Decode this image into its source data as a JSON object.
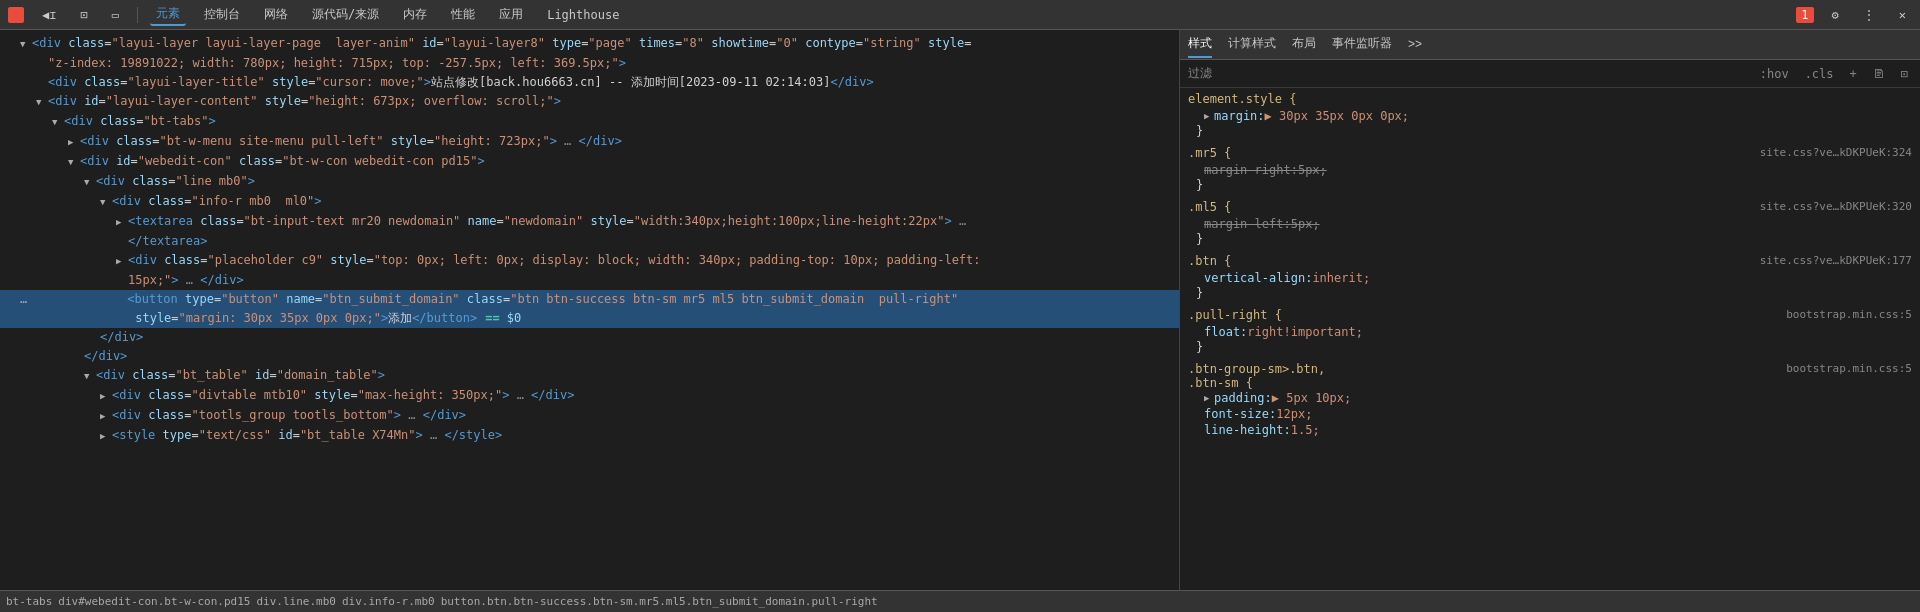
{
  "toolbar": {
    "back_icon": "◀",
    "forward_icon": "▶",
    "inspect_icon": "⊡",
    "device_icon": "▭",
    "tabs": [
      {
        "label": "元素",
        "active": true
      },
      {
        "label": "控制台"
      },
      {
        "label": "网络"
      },
      {
        "label": "源代码/来源"
      },
      {
        "label": "内存"
      },
      {
        "label": "性能"
      },
      {
        "label": "应用"
      },
      {
        "label": "Lighthouse"
      }
    ],
    "settings_icon": "⚙",
    "more_icon": "⋮",
    "close_icon": "✕",
    "brand_label": "1"
  },
  "dom": {
    "lines": [
      {
        "id": "line1",
        "indent": 0,
        "expand": "expanded",
        "content": "<div class=\"layui-layer layui-layer-page  layer-anim\" id=\"layui-layer8\" type=\"page\" times=\"8\" showtime=\"0\" contype=\"string\" style=",
        "continuation": "\"z-index: 19891022; width: 780px; height: 715px; top: -257.5px; left: 369.5px;\">",
        "selected": false
      },
      {
        "id": "line2",
        "indent": 1,
        "expand": "leaf",
        "content": "<div class=\"layui-layer-title\" style=\"cursor: move;\">站点修改[back.hou6663.cn] -- 添加时间[2023-09-11 02:14:03]</div>",
        "selected": false
      },
      {
        "id": "line3",
        "indent": 1,
        "expand": "expanded",
        "content": "<div id=\"layui-layer-content\" style=\"height: 673px; overflow: scroll;\">",
        "selected": false
      },
      {
        "id": "line4",
        "indent": 2,
        "expand": "expanded",
        "content": "<div class=\"bt-tabs\">",
        "selected": false
      },
      {
        "id": "line5",
        "indent": 3,
        "expand": "collapsed",
        "content": "<div class=\"bt-w-menu site-menu pull-left\" style=\"height: 723px;\"> … </div>",
        "selected": false
      },
      {
        "id": "line6",
        "indent": 3,
        "expand": "expanded",
        "content": "<div id=\"webedit-con\" class=\"bt-w-con webedit-con pd15\">",
        "selected": false
      },
      {
        "id": "line7",
        "indent": 4,
        "expand": "expanded",
        "content": "<div class=\"line mb0\">",
        "selected": false
      },
      {
        "id": "line8",
        "indent": 5,
        "expand": "expanded",
        "content": "<div class=\"info-r mb0  ml0\">",
        "selected": false
      },
      {
        "id": "line9",
        "indent": 6,
        "expand": "collapsed",
        "content": "<textarea class=\"bt-input-text mr20 newdomain\" name=\"newdomain\" style=\"width:340px;height:100px;line-height:22px\"> …",
        "continuation": "</textarea>",
        "selected": false
      },
      {
        "id": "line10",
        "indent": 6,
        "expand": "collapsed",
        "content": "<div class=\"placeholder c9\" style=\"top: 0px; left: 0px; display: block; width: 340px; padding-top: 10px; padding-left:",
        "continuation": "15px;\"> … </div>",
        "selected": false
      },
      {
        "id": "line11",
        "indent": 6,
        "expand": "leaf",
        "three_dots": true,
        "content": "<button type=\"button\" name=\"btn_submit_domain\" class=\"btn btn-success btn-sm mr5 ml5 btn_submit_domain  pull-right\"",
        "continuation": "  style=\"margin: 30px 35px 0px 0px;\">添加</button>",
        "equals": "== $0",
        "selected": true
      },
      {
        "id": "line12",
        "indent": 5,
        "expand": "leaf",
        "content": "</div>",
        "selected": false
      },
      {
        "id": "line13",
        "indent": 4,
        "expand": "leaf",
        "content": "</div>",
        "selected": false
      },
      {
        "id": "line14",
        "indent": 4,
        "expand": "expanded",
        "content": "<div class=\"bt_table\" id=\"domain_table\">",
        "selected": false
      },
      {
        "id": "line15",
        "indent": 5,
        "expand": "collapsed",
        "content": "<div class=\"divtable mtb10\" style=\"max-height: 350px;\"> … </div>",
        "selected": false
      },
      {
        "id": "line16",
        "indent": 5,
        "expand": "collapsed",
        "content": "<div class=\"tootls_group tootls_bottom\"> … </div>",
        "selected": false
      },
      {
        "id": "line17",
        "indent": 5,
        "expand": "collapsed",
        "content": "<style type=\"text/css\" id=\"bt_table X74Mn\"> … </style>",
        "selected": false
      }
    ]
  },
  "styles": {
    "tab_labels": [
      "样式",
      "计算样式",
      "布局",
      "事件监听器",
      ">>"
    ],
    "filter_placeholder": "过滤",
    "filter_buttons": [
      ":hov",
      ".cls",
      "+",
      "🖹",
      "⊡"
    ],
    "rules": [
      {
        "selector": "element.style {",
        "source": "",
        "properties": [
          {
            "name": "margin:",
            "value": "▶ 30px 35px 0px 0px;",
            "strikethrough": false,
            "has_expand": true
          }
        ]
      },
      {
        "selector": ".mr5 {",
        "source": "site.css?ve…kDKPUeK:324",
        "properties": [
          {
            "name": "margin-right:",
            "value": "5px;",
            "strikethrough": true
          }
        ]
      },
      {
        "selector": ".ml5 {",
        "source": "site.css?ve…kDKPUeK:320",
        "properties": [
          {
            "name": "margin-left:",
            "value": "5px;",
            "strikethrough": true
          }
        ]
      },
      {
        "selector": ".btn {",
        "source": "site.css?ve…kDKPUeK:177",
        "properties": [
          {
            "name": "vertical-align:",
            "value": "inherit;",
            "strikethrough": false
          }
        ]
      },
      {
        "selector": ".pull-right {",
        "source": "bootstrap.min.css:5",
        "properties": [
          {
            "name": "float:",
            "value": "right!important;",
            "strikethrough": false
          }
        ]
      },
      {
        "selector": ".btn-group-sm>.btn,",
        "source": "bootstrap.min.css:5",
        "selector2": ".btn-sm {",
        "properties": [
          {
            "name": "padding:",
            "value": "▶ 5px 10px;",
            "has_expand": true,
            "strikethrough": false
          },
          {
            "name": "font-size:",
            "value": "12px;",
            "strikethrough": false
          },
          {
            "name": "line-height:",
            "value": "1.5;",
            "strikethrough": false,
            "partial": true
          }
        ]
      }
    ]
  },
  "breadcrumb": {
    "items": [
      "bt-tabs",
      "div#webedit-con.bt-w-con.pd15",
      "div.line.mb0",
      "div.info-r.mb0",
      "button.btn.btn-success.btn-sm.mr5.ml5.btn_submit_domain.pull-right"
    ]
  }
}
